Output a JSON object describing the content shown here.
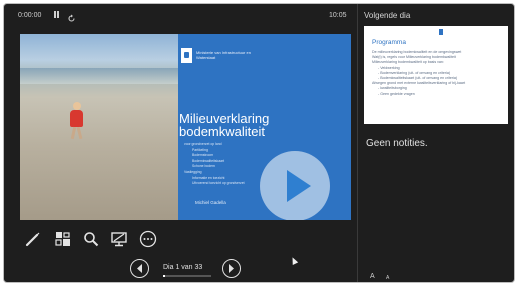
{
  "topbar": {
    "timer": "0:00:00",
    "clock": "10:05"
  },
  "next_panel": {
    "label": "Volgende dia",
    "preview": {
      "title": "Programma",
      "lines": [
        "De milieuverklaring bodemkwaliteit en de omgevingswet",
        "Wat(t) is, regels voor Milieuverklaring bodemkwaliteit",
        "Milieuverklaring bodemkwaliteit op basis van:",
        "- Veldwerking",
        "- Bodemverklaring (uit- of omvang en criteria)",
        "- Bodemkwaliteitskaart (uit- of omvang en criteria)",
        "Afwegen grond met externe kwaliteitsverklaring of bij-kaart",
        "- kwaliteitsborging",
        "- Geen gedekte vragen"
      ]
    }
  },
  "current_slide": {
    "ministry": "Ministerie van Infrastructuur en Waterstaat",
    "title": "Milieuverklaring bodemkwaliteit",
    "bullets": [
      "voor grondverzet op land",
      "Partikeling",
      "Bodemstroom",
      "Bodemkwaliteitskaart",
      "Schone bodem",
      "Vastlegging",
      "Informatie en toezicht",
      "Uitvoerend toezicht op grondverzet"
    ],
    "author": "Michiel Gadella"
  },
  "navigation": {
    "counter": "Dia 1 van 33",
    "current": 1,
    "total": 33
  },
  "notes": "Geen notities.",
  "text_size": {
    "increase_glyph": "A",
    "decrease_glyph": "A"
  },
  "icons": {
    "pause": "pause-icon",
    "reset": "reset-icon",
    "pen": "pen-icon",
    "see_all_slides": "slides-grid-icon",
    "zoom": "magnifier-icon",
    "black_screen": "monitor-icon",
    "more": "ellipsis-icon",
    "previous": "arrow-left-icon",
    "next": "arrow-right-icon",
    "play": "play-icon"
  },
  "colors": {
    "background": "#1e1e1e",
    "slide_blue": "#2e73c2",
    "play_triangle": "#2f7fd0"
  }
}
